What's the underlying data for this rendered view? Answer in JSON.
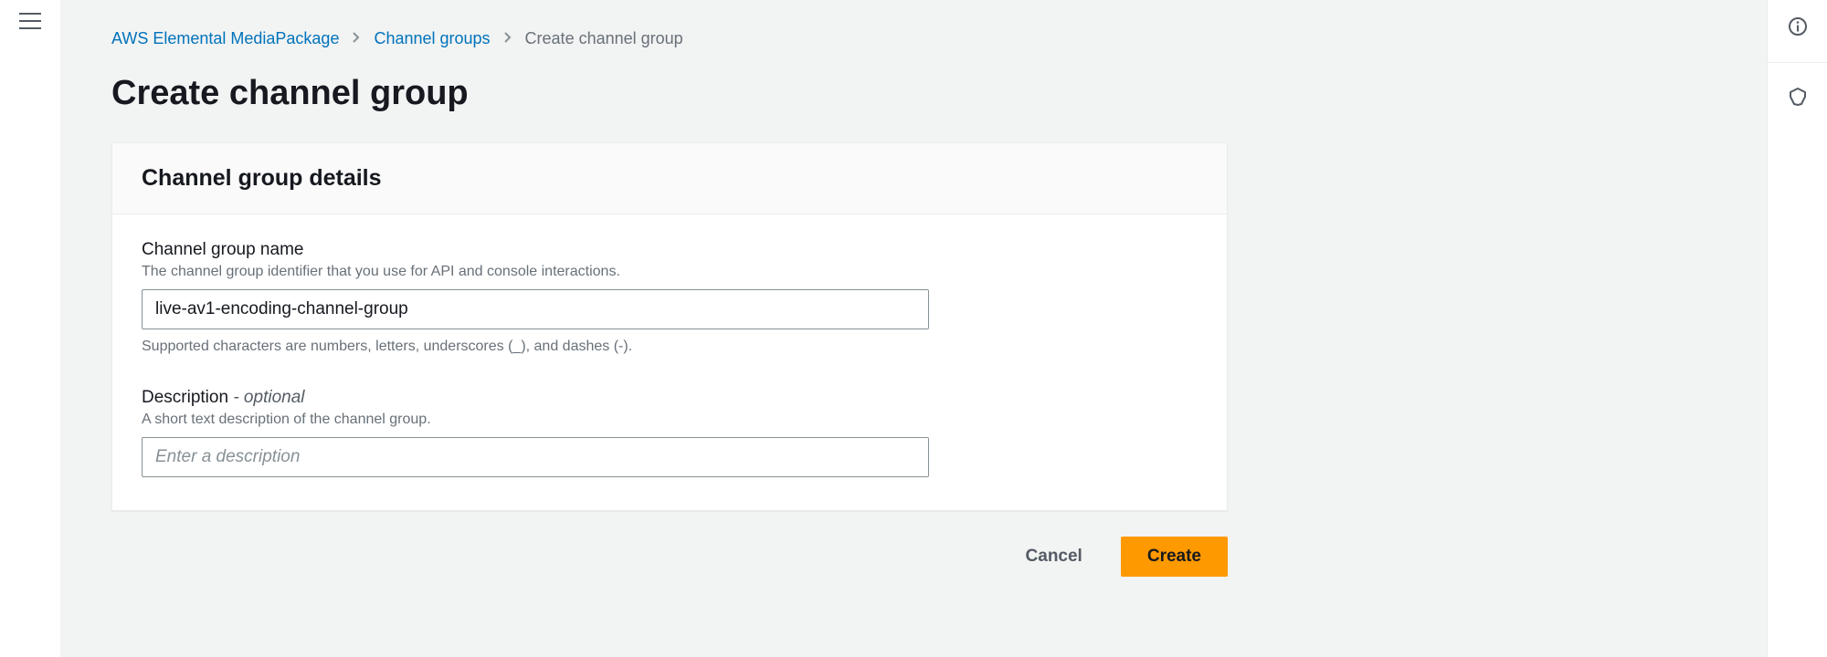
{
  "breadcrumbs": {
    "root": "AWS Elemental MediaPackage",
    "mid": "Channel groups",
    "current": "Create channel group"
  },
  "page": {
    "title": "Create channel group"
  },
  "panel": {
    "title": "Channel group details",
    "name_field": {
      "label": "Channel group name",
      "hint": "The channel group identifier that you use for API and console interactions.",
      "value": "live-av1-encoding-channel-group",
      "constraint": "Supported characters are numbers, letters, underscores (_), and dashes (-)."
    },
    "description_field": {
      "label": "Description",
      "optional_suffix": " - optional",
      "hint": "A short text description of the channel group.",
      "placeholder": "Enter a description",
      "value": ""
    }
  },
  "actions": {
    "cancel": "Cancel",
    "create": "Create"
  }
}
